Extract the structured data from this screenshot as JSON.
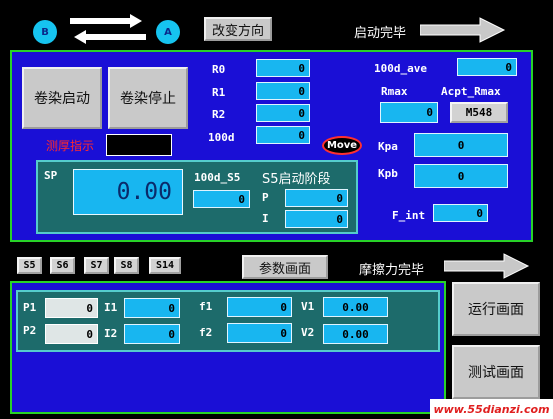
{
  "header": {
    "circle_b": "B",
    "circle_a": "A",
    "change_direction": "改变方向",
    "start_complete": "启动完毕"
  },
  "top_panel": {
    "btn_start": "卷染启动",
    "btn_stop": "卷染停止",
    "thickness_indicator": "测厚指示",
    "r0_label": "R0",
    "r0_value": "0",
    "r1_label": "R1",
    "r1_value": "0",
    "r2_label": "R2",
    "r2_value": "0",
    "d100_label": "100d",
    "d100_value": "0",
    "move_label": "Move",
    "ave_label": "100d_ave",
    "ave_value": "0",
    "rmax_label": "Rmax",
    "rmax_value": "0",
    "acpt_label": "Acpt_Rmax",
    "acpt_value": "M548",
    "kpa_label": "Kpa",
    "kpa_value": "0",
    "kpb_label": "Kpb",
    "kpb_value": "0",
    "fint_label": "F_int",
    "fint_value": "0",
    "sp_label": "SP",
    "sp_value": "0.00",
    "d100_s5_label": "100d_S5",
    "d100_s5_value": "0",
    "s5_stage": "S5启动阶段",
    "p_label": "P",
    "p_value": "0",
    "i_label": "I",
    "i_value": "0"
  },
  "step_buttons": [
    "S5",
    "S6",
    "S7",
    "S8",
    "S14"
  ],
  "param_screen": "参数画面",
  "friction_complete": "摩擦力完毕",
  "bottom_panel": {
    "p1_label": "P1",
    "p1_value": "0",
    "p2_label": "P2",
    "p2_value": "0",
    "i1_label": "I1",
    "i1_value": "0",
    "i2_label": "I2",
    "i2_value": "0",
    "f1_label": "f1",
    "f1_value": "0",
    "f2_label": "f2",
    "f2_value": "0",
    "v1_label": "V1",
    "v1_value": "0.00",
    "v2_label": "V2",
    "v2_value": "0.00"
  },
  "run_screen": "运行画面",
  "test_screen": "测试画面",
  "watermark": "www.55dianzi.com"
}
